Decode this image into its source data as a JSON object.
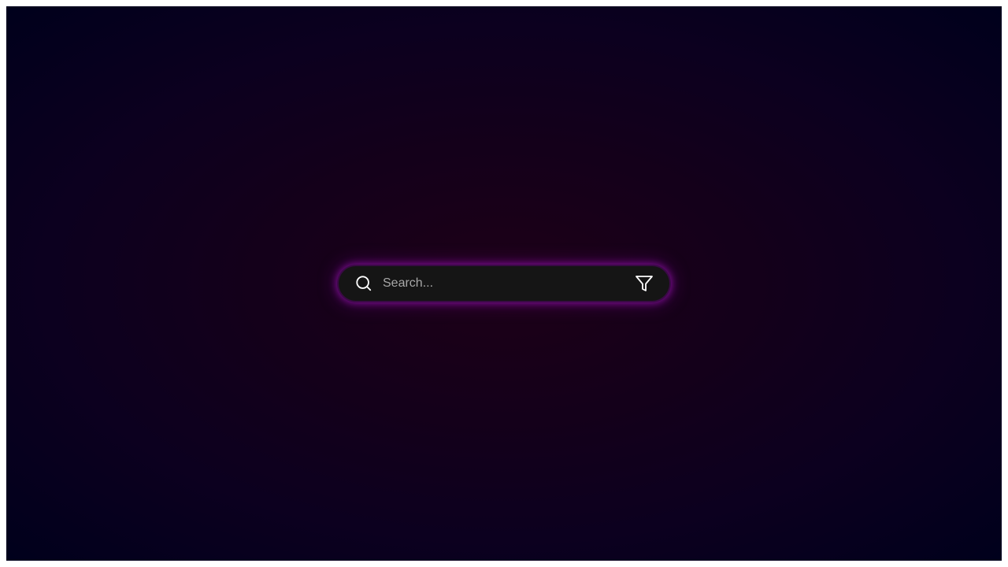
{
  "search": {
    "placeholder": "Search...",
    "value": "",
    "leading_icon": "search-icon",
    "trailing_icon": "filter-icon"
  },
  "colors": {
    "background_center": "#1d0017",
    "background_edge": "#00001c",
    "bar_fill": "#151515",
    "glow": "#aa14c8",
    "icon": "#ffffff"
  }
}
